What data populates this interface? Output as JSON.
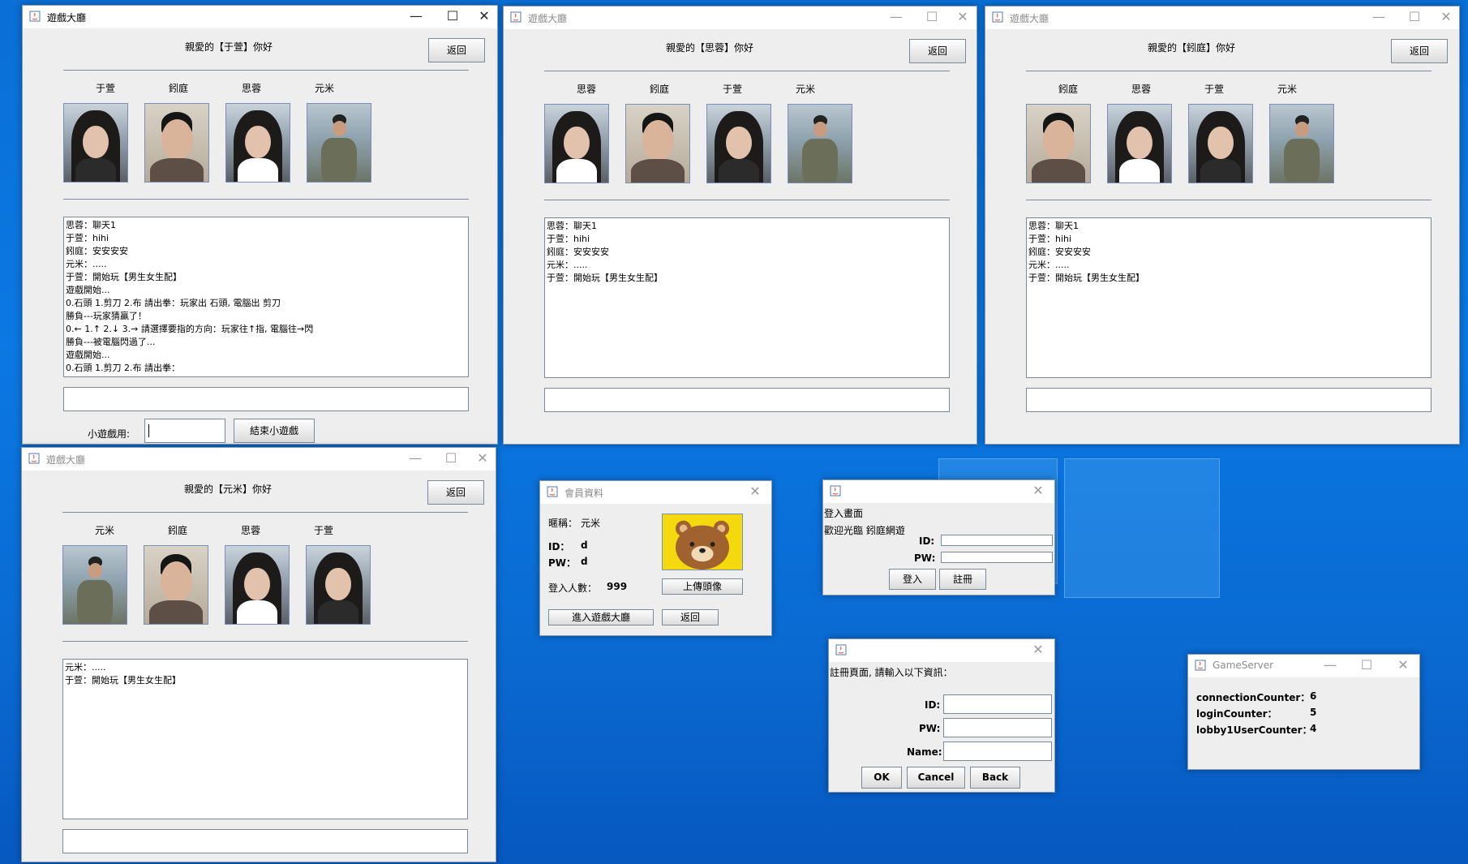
{
  "lobby_window_title": "遊戲大廳",
  "back_label": "返回",
  "windows": {
    "w1": {
      "greeting": "親愛的【于萱】你好",
      "members": [
        "于萱",
        "鈏庭",
        "思蓉",
        "元米"
      ],
      "chat": [
        "思蓉：聊天1",
        "于萱：hihi",
        "鈏庭：安安安安",
        "元米：.....",
        "于萱：開始玩【男生女生配】",
        "遊戲開始...",
        "0.石頭  1.剪刀  2.布  請出拳：玩家出 石頭, 電腦出 剪刀",
        "勝負---玩家猜贏了！",
        "0.←  1.↑  2.↓  3.→  請選擇要指的方向：玩家往↑指, 電腦往→閃",
        "勝負---被電腦閃過了...",
        "遊戲開始...",
        "0.石頭  1.剪刀  2.布  請出拳："
      ],
      "minigame_label": "小遊戲用:",
      "end_minigame_label": "結束小遊戲"
    },
    "w2": {
      "greeting": "親愛的【思蓉】你好",
      "members": [
        "思蓉",
        "鈏庭",
        "于萱",
        "元米"
      ],
      "chat": [
        "思蓉：聊天1",
        "于萱：hihi",
        "鈏庭：安安安安",
        "元米：.....",
        "于萱：開始玩【男生女生配】"
      ]
    },
    "w3": {
      "greeting": "親愛的【鈏庭】你好",
      "members": [
        "鈏庭",
        "思蓉",
        "于萱",
        "元米"
      ],
      "chat": [
        "思蓉：聊天1",
        "于萱：hihi",
        "鈏庭：安安安安",
        "元米：.....",
        "于萱：開始玩【男生女生配】"
      ]
    },
    "w4": {
      "greeting": "親愛的【元米】你好",
      "members": [
        "元米",
        "鈏庭",
        "思蓉",
        "于萱"
      ],
      "chat": [
        "元米：.....",
        "于萱：開始玩【男生女生配】"
      ]
    }
  },
  "member_window": {
    "title": "會員資料",
    "nickname_label": "暱稱：",
    "nickname": "元米",
    "id_label": "ID：",
    "id": "d",
    "pw_label": "PW：",
    "pw": "d",
    "online_label": "登入人數：",
    "online_count": "999",
    "upload_label": "上傳頭像",
    "enter_lobby_label": "進入遊戲大廳",
    "back_label": "返回"
  },
  "login_window": {
    "heading": "登入畫面",
    "welcome": "歡迎光臨 鈏庭網遊",
    "id_label": "ID:",
    "pw_label": "PW:",
    "login_label": "登入",
    "register_label": "註冊"
  },
  "register_window": {
    "heading": "註冊頁面, 請輸入以下資訊：",
    "id_label": "ID:",
    "pw_label": "PW:",
    "name_label": "Name:",
    "ok_label": "OK",
    "cancel_label": "Cancel",
    "back_label": "Back"
  },
  "server_window": {
    "title": "GameServer",
    "rows": [
      {
        "label": "connectionCounter：",
        "value": "6"
      },
      {
        "label": "loginCounter：",
        "value": "5"
      },
      {
        "label": "lobby1UserCounter：",
        "value": "4"
      }
    ]
  },
  "window_controls": {
    "minimize": "—",
    "maximize": "☐",
    "close": "✕"
  },
  "colors": {
    "desktop": "#0b78e3",
    "window_bg": "#eeeeee",
    "separator": "#7b8ca3"
  }
}
